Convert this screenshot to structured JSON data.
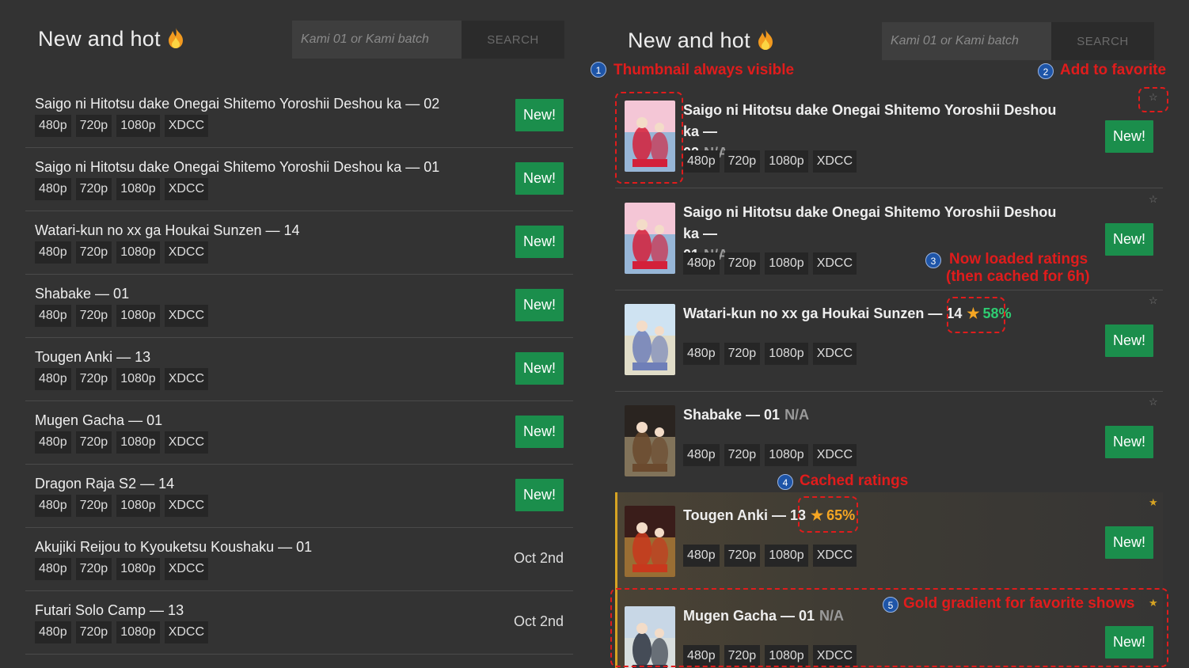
{
  "left": {
    "title": "New and hot",
    "search": {
      "placeholder": "Kami 01 or Kami batch",
      "button": "SEARCH"
    },
    "rows": [
      {
        "name": "Saigo ni Hitotsu dake Onegai Shitemo Yoroshii Deshou ka — 02",
        "status": "New!"
      },
      {
        "name": "Saigo ni Hitotsu dake Onegai Shitemo Yoroshii Deshou ka — 01",
        "status": "New!"
      },
      {
        "name": "Watari-kun no xx ga Houkai Sunzen — 14",
        "status": "New!"
      },
      {
        "name": "Shabake — 01",
        "status": "New!"
      },
      {
        "name": "Tougen Anki — 13",
        "status": "New!"
      },
      {
        "name": "Mugen Gacha — 01",
        "status": "New!"
      },
      {
        "name": "Dragon Raja S2 — 14",
        "status": "New!"
      },
      {
        "name": "Akujiki Reijou to Kyouketsu Koushaku — 01",
        "date": "Oct 2nd"
      },
      {
        "name": "Futari Solo Camp — 13",
        "date": "Oct 2nd"
      }
    ]
  },
  "tags": [
    "480p",
    "720p",
    "1080p",
    "XDCC"
  ],
  "right": {
    "title": "New and hot",
    "search": {
      "placeholder": "Kami 01 or Kami batch",
      "button": "SEARCH"
    },
    "rows": [
      {
        "name_line1": "Saigo ni Hitotsu dake Onegai Shitemo Yoroshii Deshou ka —",
        "name_line2": "02",
        "rating": "N/A",
        "status": "New!",
        "star": "☆"
      },
      {
        "name_line1": "Saigo ni Hitotsu dake Onegai Shitemo Yoroshii Deshou ka —",
        "name_line2": "01",
        "rating": "N/A",
        "status": "New!",
        "star": "☆"
      },
      {
        "name_line1": "Watari-kun no xx ga Houkai Sunzen — 14",
        "rating_star": "★",
        "rating": "58%",
        "status": "New!",
        "star": "☆"
      },
      {
        "name_line1": "Shabake — 01",
        "rating": "N/A",
        "status": "New!",
        "star": "☆"
      },
      {
        "name_line1": "Tougen Anki — 13",
        "rating_star": "★",
        "rating": "65%",
        "status": "New!",
        "star": "★"
      },
      {
        "name_line1": "Mugen Gacha — 01",
        "rating": "N/A",
        "status": "New!",
        "star": "★"
      }
    ]
  },
  "annotations": {
    "a1": {
      "num": "1",
      "text": "Thumbnail always visible"
    },
    "a2": {
      "num": "2",
      "text": "Add to favorite"
    },
    "a3": {
      "num": "3",
      "text": "Now loaded ratings",
      "text2": "(then cached for 6h)"
    },
    "a4": {
      "num": "4",
      "text": "Cached ratings"
    },
    "a5": {
      "num": "5",
      "text": "Gold gradient for favorite shows"
    }
  },
  "colors": {
    "new_button": "#1b8e4c",
    "rating_green": "#2ecc71",
    "rating_orange": "#f5a623",
    "favorite_gold": "#d6a323",
    "annotation_red": "#e01c1c"
  }
}
